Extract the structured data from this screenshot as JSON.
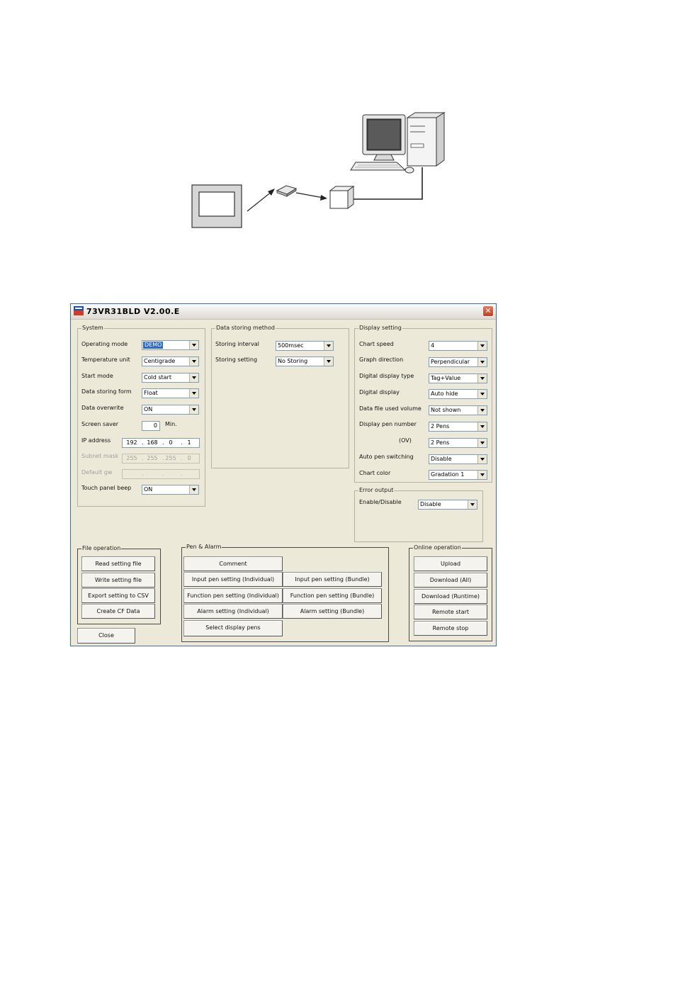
{
  "window": {
    "title": "73VR31BLD V2.00.E",
    "close_glyph": "✕"
  },
  "system": {
    "group_title": "System",
    "operating_mode": {
      "label": "Operating mode",
      "value": "DEMO"
    },
    "temperature_unit": {
      "label": "Temperature unit",
      "value": "Centigrade"
    },
    "start_mode": {
      "label": "Start mode",
      "value": "Cold start"
    },
    "data_storing_form": {
      "label": "Data storing form",
      "value": "Float"
    },
    "data_overwrite": {
      "label": "Data overwrite",
      "value": "ON"
    },
    "screen_saver": {
      "label": "Screen saver",
      "value": "0",
      "unit": "Min."
    },
    "ip_address": {
      "label": "IP address",
      "octets": [
        "192",
        "168",
        "0",
        "1"
      ]
    },
    "subnet_mask": {
      "label": "Subnet mask",
      "octets": [
        "255",
        "255",
        "255",
        "0"
      ]
    },
    "default_gw": {
      "label": "Default gw",
      "octets": [
        "",
        "",
        "",
        ""
      ]
    },
    "touch_panel_beep": {
      "label": "Touch panel beep",
      "value": "ON"
    }
  },
  "data_storing": {
    "group_title": "Data storing method",
    "storing_interval": {
      "label": "Storing interval",
      "value": "500msec"
    },
    "storing_setting": {
      "label": "Storing setting",
      "value": "No Storing"
    }
  },
  "display_setting": {
    "group_title": "Display setting",
    "chart_speed": {
      "label": "Chart speed",
      "value": "4"
    },
    "graph_direction": {
      "label": "Graph direction",
      "value": "Perpendicular"
    },
    "digital_display_type": {
      "label": "Digital display type",
      "value": "Tag+Value"
    },
    "digital_display": {
      "label": "Digital display",
      "value": "Auto hide"
    },
    "data_file_used_volume": {
      "label": "Data file used volume",
      "value": "Not shown"
    },
    "display_pen_number": {
      "label": "Display pen number",
      "value": "2 Pens"
    },
    "ov": {
      "label": "(OV)",
      "value": "2 Pens"
    },
    "auto_pen_switching": {
      "label": "Auto pen switching",
      "value": "Disable"
    },
    "chart_color": {
      "label": "Chart color",
      "value": "Gradation 1"
    }
  },
  "error_output": {
    "group_title": "Error output",
    "enable_disable": {
      "label": "Enable/Disable",
      "value": "Disable"
    }
  },
  "file_operation": {
    "group_title": "File operation",
    "buttons": [
      "Read setting file",
      "Write setting file",
      "Export setting to CSV",
      "Create CF Data"
    ]
  },
  "close_button": "Close",
  "pen_alarm": {
    "group_title": "Pen & Alarm",
    "comment": "Comment",
    "input_individual": "Input pen setting (Individual)",
    "input_bundle": "Input pen setting (Bundle)",
    "function_individual": "Function pen setting (Individual)",
    "function_bundle": "Function pen setting (Bundle)",
    "alarm_individual": "Alarm setting (Individual)",
    "alarm_bundle": "Alarm setting (Bundle)",
    "select_display_pens": "Select display pens"
  },
  "online_operation": {
    "group_title": "Online operation",
    "buttons": [
      "Upload",
      "Download (All)",
      "Download (Runtime)",
      "Remote start",
      "Remote stop"
    ]
  },
  "colors": {
    "window_bg": "#ece9d8",
    "selection": "#316ac5",
    "close_button": "#c03e22"
  }
}
